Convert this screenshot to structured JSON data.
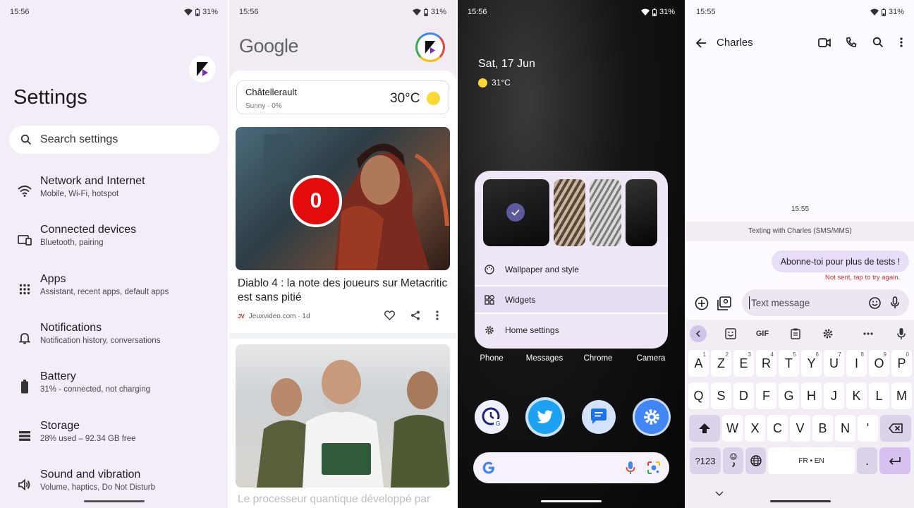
{
  "settings": {
    "time": "15:56",
    "battery": "31%",
    "title": "Settings",
    "search_placeholder": "Search settings",
    "items": [
      {
        "title": "Network and Internet",
        "sub": "Mobile, Wi-Fi, hotspot",
        "icon": "wifi-icon"
      },
      {
        "title": "Connected devices",
        "sub": "Bluetooth, pairing",
        "icon": "devices-icon"
      },
      {
        "title": "Apps",
        "sub": "Assistant, recent apps, default apps",
        "icon": "apps-grid-icon"
      },
      {
        "title": "Notifications",
        "sub": "Notification history, conversations",
        "icon": "bell-icon"
      },
      {
        "title": "Battery",
        "sub": "31% - connected, not charging",
        "icon": "battery-icon"
      },
      {
        "title": "Storage",
        "sub": "28% used – 92.34 GB free",
        "icon": "storage-icon"
      },
      {
        "title": "Sound and vibration",
        "sub": "Volume, haptics, Do Not Disturb",
        "icon": "speaker-icon"
      }
    ]
  },
  "discover": {
    "time": "15:56",
    "battery": "31%",
    "logo": "Google",
    "weather": {
      "city": "Châtellerault",
      "sub": "Sunny · 0%",
      "temp": "30°C"
    },
    "card1": {
      "badge": "0",
      "headline": "Diablo 4 : la note des joueurs sur Metacritic est sans pitié",
      "source": "Jeuxvideo.com · 1d",
      "source_logo": "JV"
    },
    "card2": {
      "headline": "Le processeur quantique développé par"
    }
  },
  "home": {
    "time": "15:56",
    "battery": "31%",
    "date": "Sat, 17 Jun",
    "weather": "31°C",
    "menu": [
      "Wallpaper and style",
      "Widgets",
      "Home settings"
    ],
    "dock": [
      "Phone",
      "Messages",
      "Chrome",
      "Camera"
    ]
  },
  "messages": {
    "time": "15:55",
    "battery": "31%",
    "contact": "Charles",
    "timestamp": "15:55",
    "texting_with": "Texting with Charles (SMS/MMS)",
    "message": "Abonne-toi pour plus de tests !",
    "error": "Not sent, tap to try again.",
    "compose_placeholder": "Text message",
    "gif_label": "GIF",
    "row1": [
      "A",
      "Z",
      "E",
      "R",
      "T",
      "Y",
      "U",
      "I",
      "O",
      "P"
    ],
    "row1_sup": [
      "1",
      "2",
      "3",
      "4",
      "5",
      "6",
      "7",
      "8",
      "9",
      "0"
    ],
    "row2": [
      "Q",
      "S",
      "D",
      "F",
      "G",
      "H",
      "J",
      "K",
      "L",
      "M"
    ],
    "row3": [
      "W",
      "X",
      "C",
      "V",
      "B",
      "N",
      "'"
    ],
    "sym_key": "?123",
    "space_label": "FR • EN",
    "period": "."
  }
}
